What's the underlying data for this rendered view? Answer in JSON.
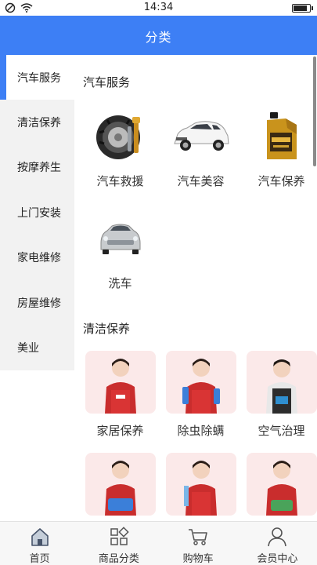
{
  "status_bar": {
    "time": "14:34"
  },
  "header": {
    "title": "分类"
  },
  "sidebar": {
    "items": [
      {
        "label": "汽车服务",
        "active": true
      },
      {
        "label": "清洁保养"
      },
      {
        "label": "按摩养生"
      },
      {
        "label": "上门安装"
      },
      {
        "label": "家电维修"
      },
      {
        "label": "房屋维修"
      },
      {
        "label": "美业"
      }
    ]
  },
  "sections": [
    {
      "title": "汽车服务",
      "items": [
        {
          "label": "汽车救援",
          "icon": "tire-wrench-icon"
        },
        {
          "label": "汽车美容",
          "icon": "white-suv-icon"
        },
        {
          "label": "汽车保养",
          "icon": "motor-oil-icon"
        },
        {
          "label": "洗车",
          "icon": "silver-sedan-icon"
        }
      ]
    },
    {
      "title": "清洁保养",
      "items": [
        {
          "label": "家居保养",
          "icon": "cleaner-woman-icon"
        },
        {
          "label": "除虫除螨",
          "icon": "cleaner-woman-spray-icon"
        },
        {
          "label": "空气治理",
          "icon": "cleaner-man-icon"
        },
        {
          "label": "",
          "icon": "cleaner-woman-icon"
        },
        {
          "label": "",
          "icon": "cleaner-woman-icon"
        },
        {
          "label": "",
          "icon": "cleaner-woman-icon"
        }
      ]
    }
  ],
  "tabbar": {
    "items": [
      {
        "label": "首页",
        "icon": "home-icon"
      },
      {
        "label": "商品分类",
        "icon": "category-grid-icon"
      },
      {
        "label": "购物车",
        "icon": "cart-icon"
      },
      {
        "label": "会员中心",
        "icon": "user-icon"
      }
    ]
  },
  "colors": {
    "accent": "#3d7ff5",
    "sidebar_bg": "#f2f2f2"
  }
}
